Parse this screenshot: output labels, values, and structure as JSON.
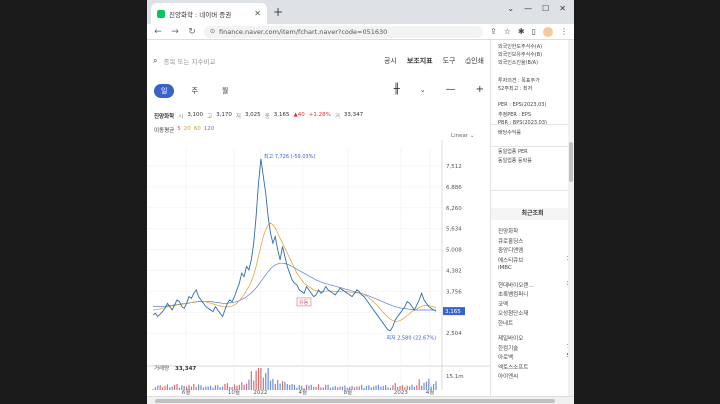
{
  "browser": {
    "tab_title": "진양화학 : 네이버 증권",
    "url": "finance.naver.com/item/fchart.naver?code=051630"
  },
  "search": {
    "placeholder": "종목 또는 지수비교"
  },
  "menu": {
    "items": [
      "공시",
      "보조지표",
      "도구",
      "인쇄"
    ]
  },
  "periods": [
    "일",
    "주",
    "월"
  ],
  "stock": {
    "name": "진양화학",
    "open_label": "시",
    "open": "3,100",
    "high_label": "고",
    "high": "3,170",
    "low_label": "저",
    "low": "3,025",
    "close_label": "종",
    "close": "3,165",
    "change": "▲40",
    "change_pct": "+1.28%",
    "volume_label": "거",
    "volume": "33,347"
  },
  "ma": {
    "label": "이동평균",
    "items": [
      {
        "v": "5",
        "c": "#e5486a"
      },
      {
        "v": "20",
        "c": "#e39c2a"
      },
      {
        "v": "60",
        "c": "#c6a33a"
      },
      {
        "v": "120",
        "c": "#5b7bd6"
      }
    ]
  },
  "scale_mode": "Linear",
  "colors": {
    "accent": "#3a63c9",
    "up": "#d33333",
    "down": "#3a63c9"
  },
  "chart_data": {
    "type": "line",
    "y_ticks": [
      "7,512",
      "6,886",
      "6,260",
      "5,634",
      "5,008",
      "4,382",
      "3,756",
      "3,130",
      "2,504"
    ],
    "x_ticks": [
      "6월",
      "10월",
      "2022",
      "4월",
      "8월",
      "2023",
      "4월"
    ],
    "ylim": [
      2360,
      8050
    ],
    "current_price": "3,165",
    "max_label": "최고 7,726 (-59.03%)",
    "min_label": "최저 2,580 (22.67%)",
    "marker_label": "유동",
    "volume_label": "거래량",
    "volume_value": "33,347",
    "volume_axis": "15.1m",
    "price": [
      3050,
      3100,
      3000,
      3080,
      3150,
      3250,
      3400,
      3300,
      3200,
      3350,
      3500,
      3450,
      3300,
      3250,
      3400,
      3600,
      3550,
      3700,
      3800,
      3600,
      3500,
      3400,
      3300,
      3250,
      3200,
      3150,
      3300,
      3200,
      3100,
      3000,
      3200,
      3400,
      3500,
      3450,
      3600,
      3800,
      4000,
      4300,
      4200,
      4500,
      4400,
      4700,
      5200,
      6000,
      7000,
      7726,
      7200,
      6700,
      6000,
      5500,
      5200,
      5400,
      5000,
      4700,
      5100,
      4800,
      4500,
      4300,
      4100,
      4000,
      3950,
      3800,
      3750,
      3700,
      3900,
      3800,
      3700,
      3600,
      3650,
      3800,
      3700,
      3750,
      3900,
      3800,
      3750,
      3700,
      3650,
      3750,
      3850,
      3800,
      3750,
      3700,
      3650,
      3600,
      3700,
      3800,
      3750,
      3650,
      3600,
      3500,
      3400,
      3300,
      3200,
      3100,
      3000,
      2900,
      2800,
      2700,
      2600,
      2580,
      2700,
      2900,
      3000,
      3100,
      3200,
      3300,
      3450,
      3400,
      3300,
      3200,
      3350,
      3500,
      3700,
      3500,
      3400,
      3300,
      3250,
      3200,
      3165
    ],
    "ma20": [
      3200,
      3210,
      3220,
      3230,
      3250,
      3270,
      3290,
      3310,
      3320,
      3330,
      3350,
      3360,
      3370,
      3380,
      3390,
      3400,
      3420,
      3440,
      3450,
      3460,
      3460,
      3450,
      3440,
      3420,
      3400,
      3380,
      3360,
      3340,
      3320,
      3300,
      3290,
      3290,
      3300,
      3320,
      3350,
      3400,
      3480,
      3560,
      3660,
      3780,
      3900,
      4050,
      4250,
      4500,
      4800,
      5100,
      5400,
      5600,
      5750,
      5800,
      5750,
      5650,
      5500,
      5350,
      5200,
      5050,
      4900,
      4750,
      4600,
      4450,
      4300,
      4200,
      4100,
      4000,
      3950,
      3900,
      3850,
      3800,
      3780,
      3760,
      3750,
      3750,
      3760,
      3770,
      3770,
      3760,
      3750,
      3750,
      3760,
      3770,
      3760,
      3750,
      3740,
      3720,
      3710,
      3710,
      3700,
      3690,
      3660,
      3620,
      3570,
      3510,
      3440,
      3370,
      3290,
      3210,
      3130,
      3050,
      2980,
      2920,
      2880,
      2860,
      2860,
      2880,
      2920,
      2970,
      3030,
      3090,
      3150,
      3190,
      3230,
      3270,
      3310,
      3330,
      3340,
      3330,
      3310,
      3290,
      3270
    ],
    "ma120": [
      3300,
      3300,
      3300,
      3300,
      3300,
      3310,
      3320,
      3330,
      3340,
      3350,
      3360,
      3370,
      3380,
      3390,
      3400,
      3410,
      3420,
      3430,
      3440,
      3450,
      3450,
      3450,
      3450,
      3450,
      3450,
      3440,
      3430,
      3420,
      3410,
      3400,
      3400,
      3400,
      3410,
      3420,
      3430,
      3450,
      3480,
      3510,
      3550,
      3600,
      3650,
      3710,
      3780,
      3860,
      3950,
      4050,
      4150,
      4250,
      4350,
      4430,
      4500,
      4550,
      4580,
      4600,
      4600,
      4590,
      4570,
      4540,
      4500,
      4460,
      4420,
      4380,
      4340,
      4300,
      4260,
      4220,
      4180,
      4140,
      4100,
      4070,
      4040,
      4010,
      3990,
      3970,
      3950,
      3930,
      3910,
      3890,
      3870,
      3850,
      3830,
      3810,
      3790,
      3770,
      3750,
      3730,
      3710,
      3690,
      3670,
      3650,
      3620,
      3590,
      3560,
      3530,
      3500,
      3470,
      3440,
      3410,
      3380,
      3350,
      3320,
      3300,
      3280,
      3260,
      3250,
      3240,
      3230,
      3220,
      3210,
      3200,
      3200,
      3200,
      3200,
      3200,
      3200,
      3200,
      3200,
      3200,
      3200
    ]
  },
  "sidebar": {
    "top_lines": [
      "외국인한도주식수(A)",
      "외국인보유주식수(B)",
      "외국인소진율(B/A)",
      "투자의견 : 목표주가",
      "52주최고 : 최저",
      "PER : EPS(2023.03)",
      "추정PER : EPS",
      "PBR : BPS(2023.03)",
      "배당수익률",
      "동일업종 PER",
      "동일업종 등락률"
    ],
    "recent_title": "최근조회",
    "recent": [
      {
        "name": "진양화학",
        "n": ""
      },
      {
        "name": "큐로홀딩스",
        "n": ""
      },
      {
        "name": "중앙디앤엠",
        "n": ""
      },
      {
        "name": "에스티큐브",
        "n": "1"
      },
      {
        "name": "iMBC",
        "n": ""
      },
      {
        "name": "현대바이오랜…",
        "n": "3"
      },
      {
        "name": "초록뱀컴퍼니",
        "n": ""
      },
      {
        "name": "코맥",
        "n": ""
      },
      {
        "name": "오성첨단소재",
        "n": ""
      },
      {
        "name": "한네트",
        "n": ""
      },
      {
        "name": "제일바이오",
        "n": ""
      },
      {
        "name": "한컴기술",
        "n": "7"
      },
      {
        "name": "아로백",
        "n": "5"
      },
      {
        "name": "엑토스소프트",
        "n": ""
      },
      {
        "name": "아이엔씨",
        "n": ""
      }
    ]
  }
}
